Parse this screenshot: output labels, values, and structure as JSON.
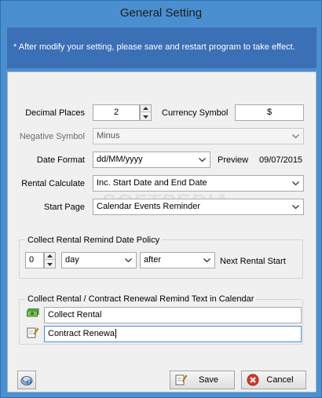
{
  "window": {
    "title": "General Setting"
  },
  "notice": {
    "text": "* After modify your setting, please save and restart program to take effect."
  },
  "settings": {
    "decimal_places_label": "Decimal Places",
    "decimal_places_value": "2",
    "currency_symbol_label": "Currency Symbol",
    "currency_symbol_value": "$",
    "negative_symbol_label": "Negative Symbol",
    "negative_symbol_value": "Minus",
    "date_format_label": "Date Format",
    "date_format_value": "dd/MM/yyyy",
    "preview_label": "Preview",
    "preview_value": "09/07/2015",
    "rental_calculate_label": "Rental Calculate",
    "rental_calculate_value": "Inc. Start Date and End Date",
    "start_page_label": "Start Page",
    "start_page_value": "Calendar Events Reminder"
  },
  "remind_policy": {
    "group_title": "Collect Rental Remind Date Policy",
    "count_value": "0",
    "unit_value": "day",
    "direction_value": "after",
    "suffix_text": "Next Rental Start"
  },
  "remind_text": {
    "group_title": "Collect Rental / Contract Renewal Remind Text in Calendar",
    "collect_rental_value": "Collect Rental",
    "contract_renewal_value": "Contract Renewa"
  },
  "footer": {
    "save_label": "Save",
    "cancel_label": "Cancel"
  },
  "watermark_text": "SOFTPEDIA",
  "colors": {
    "window_frame": "#4a8fd0",
    "notice_background": "#3b6fb6",
    "client_background": "#f0f0f0"
  }
}
